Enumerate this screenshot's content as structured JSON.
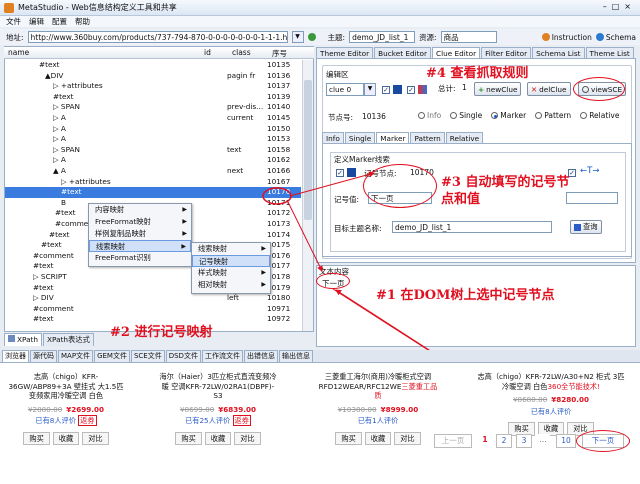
{
  "window": {
    "title": "MetaStudio - Web信息结构定义工具和共享"
  },
  "menu": [
    "文件",
    "编辑",
    "配置",
    "帮助"
  ],
  "address": {
    "label": "地址:",
    "url": "http://www.360buy.com/products/737-794-870-0-0-0-0-0-0-0-1-1-1.html",
    "theme_label": "主题:",
    "theme_value": "demo_JD_list_1",
    "resource_label": "资源:",
    "resource_value": "商品",
    "instruction": "Instruction",
    "schema": "Schema"
  },
  "tree": {
    "headers": {
      "name": "name",
      "id": "id",
      "class": "class",
      "seq": "序号"
    },
    "rows": [
      {
        "name": "#text",
        "cls": "",
        "seq": "10135"
      },
      {
        "name": "▲DIV",
        "cls": "pagin fr",
        "seq": "10136"
      },
      {
        "name": "▷ +attributes",
        "cls": "",
        "seq": "10137"
      },
      {
        "name": "#text",
        "cls": "",
        "seq": "10139"
      },
      {
        "name": "▷ SPAN",
        "cls": "prev-dis...",
        "seq": "10140"
      },
      {
        "name": "▷ A",
        "cls": "current",
        "seq": "10145"
      },
      {
        "name": "▷ A",
        "cls": "",
        "seq": "10150"
      },
      {
        "name": "▷ A",
        "cls": "",
        "seq": "10153"
      },
      {
        "name": "▷ SPAN",
        "cls": "text",
        "seq": "10158"
      },
      {
        "name": "▷ A",
        "cls": "",
        "seq": "10162"
      },
      {
        "name": "▲ A",
        "cls": "next",
        "seq": "10166"
      },
      {
        "name": "▷ +attributes",
        "cls": "",
        "seq": "10167"
      },
      {
        "name": "#text",
        "cls": "",
        "seq": "10170"
      },
      {
        "name": "B",
        "cls": "",
        "seq": "10171"
      },
      {
        "name": "#text",
        "cls": "",
        "seq": "10172"
      },
      {
        "name": "#comment",
        "cls": "",
        "seq": "10173"
      },
      {
        "name": "#text",
        "cls": "",
        "seq": "10174"
      },
      {
        "name": "#text",
        "cls": "",
        "seq": "10175"
      },
      {
        "name": "#comment",
        "cls": "",
        "seq": "10176"
      },
      {
        "name": "#text",
        "cls": "",
        "seq": "10177"
      },
      {
        "name": "▷ SCRIPT",
        "cls": "",
        "seq": "10178"
      },
      {
        "name": "#text",
        "cls": "",
        "seq": "10179"
      },
      {
        "name": "▷ DIV",
        "cls": "left",
        "seq": "10180"
      },
      {
        "name": "#comment",
        "cls": "",
        "seq": "10971"
      },
      {
        "name": "#text",
        "cls": "",
        "seq": "10972"
      }
    ]
  },
  "context_menu": {
    "items": [
      "内容映射",
      "FreeFormat映射",
      "样例复制品映射",
      "线索映射",
      "FreeFormat识别"
    ],
    "sub1": [
      "线索映射",
      "记号映射",
      "样式映射",
      "相对映射"
    ]
  },
  "left_tabs": [
    "XPath",
    "XPath表达式"
  ],
  "right_tabs": [
    "Theme Editor",
    "Bucket Editor",
    "Clue Editor",
    "Filter Editor",
    "Schema List",
    "Theme List"
  ],
  "clue_editor": {
    "group_label": "编辑区",
    "clue_select": "clue 0",
    "total_label": "总计:",
    "total_value": "1",
    "new_clue": "newClue",
    "del_clue": "delClue",
    "view_sce": "viewSCE",
    "node_label": "节点号:",
    "node_value": "10136",
    "modes": [
      "Info",
      "Single",
      "Marker",
      "Pattern",
      "Relative"
    ],
    "sub_tabs": [
      "Info",
      "Single",
      "Marker",
      "Pattern",
      "Relative"
    ],
    "marker_group": "定义Marker线索",
    "marker_node_label": "记号节点:",
    "marker_node_value": "10170",
    "marker_value_label": "记号值:",
    "marker_value": "下一页",
    "target_label": "目标主题名称:",
    "target_value": "demo_JD_list_1",
    "query_btn": "查询",
    "arrow_text": "←T→"
  },
  "text_content": {
    "label": "文本内容",
    "value": "下一页"
  },
  "annotations": {
    "a1": "#1 在DOM树上选中记号节点",
    "a2": "#2 进行记号映射",
    "a3": "#3 自动填写的记号节点和值",
    "a4": "#4 查看抓取规则"
  },
  "bottom_tabs": [
    "浏览器",
    "源代码",
    "MAP文件",
    "GEM文件",
    "SCE文件",
    "DSD文件",
    "工作流文件",
    "出错信息",
    "输出信息"
  ],
  "products": [
    {
      "title": "志高（chigo）KFR-36GW/ABP89+3A 壁挂式 大1.5匹变频家用冷暖空调 白色",
      "sub": "",
      "old": "¥2880.00",
      "new": "¥2699.00",
      "rev": "已有8人评价",
      "badge": "返券"
    },
    {
      "title": "海尔（Haier）3匹立柜式直流变频冷暖 空调KFR-72LW/02RA1(DBPF)-S3",
      "sub": "",
      "old": "¥8699.00",
      "new": "¥6839.00",
      "rev": "已有25人评价",
      "badge": "返券"
    },
    {
      "title": "三菱重工海尔(商用)冷暖柜式空调 RFD12WEAR/RFC12WE",
      "sub": "三菱重工品质",
      "old": "¥10380.00",
      "new": "¥8999.00",
      "rev": "已有1人评价",
      "badge": ""
    },
    {
      "title": "志高（chigo）KFR-72LW/A30+N2 柜式 3匹冷暖空调 白色",
      "sub": "360全节能技术!",
      "old": "¥8680.00",
      "new": "¥8280.00",
      "rev": "已有8人评价",
      "badge": ""
    }
  ],
  "product_buttons": [
    "购买",
    "收藏",
    "对比"
  ],
  "pagination": {
    "prev": "上一页",
    "pages": [
      "1",
      "2",
      "3"
    ],
    "ellipsis": "...",
    "last": "10",
    "next": "下一页"
  }
}
